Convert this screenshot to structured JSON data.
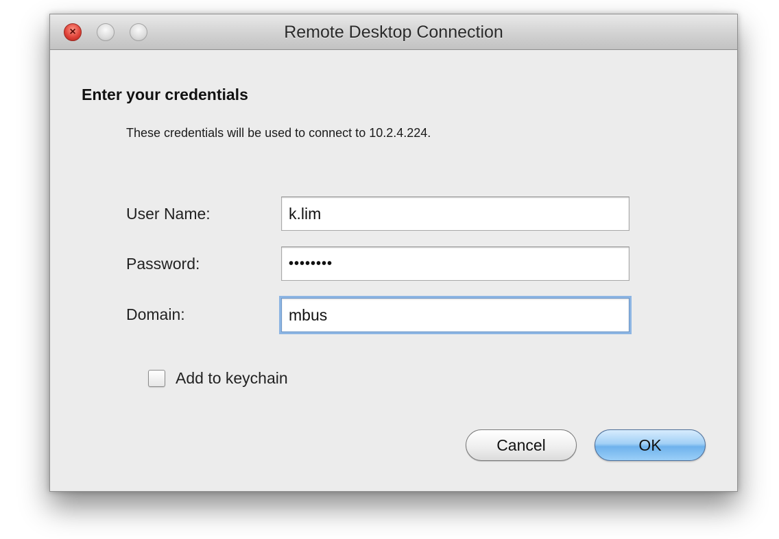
{
  "window": {
    "title": "Remote Desktop Connection",
    "close_glyph": "×"
  },
  "dialog": {
    "heading": "Enter your credentials",
    "subtext": "These credentials will be used to connect to 10.2.4.224."
  },
  "form": {
    "username_label": "User Name:",
    "username_value": "k.lim",
    "password_label": "Password:",
    "password_value": "••••••••",
    "domain_label": "Domain:",
    "domain_value": "mbus",
    "keychain_label": "Add to keychain",
    "keychain_checked": false
  },
  "buttons": {
    "cancel_label": "Cancel",
    "ok_label": "OK"
  },
  "colors": {
    "window_bg": "#ececec",
    "default_button": "#6fb2ec",
    "focus_ring": "#8db5e3"
  }
}
